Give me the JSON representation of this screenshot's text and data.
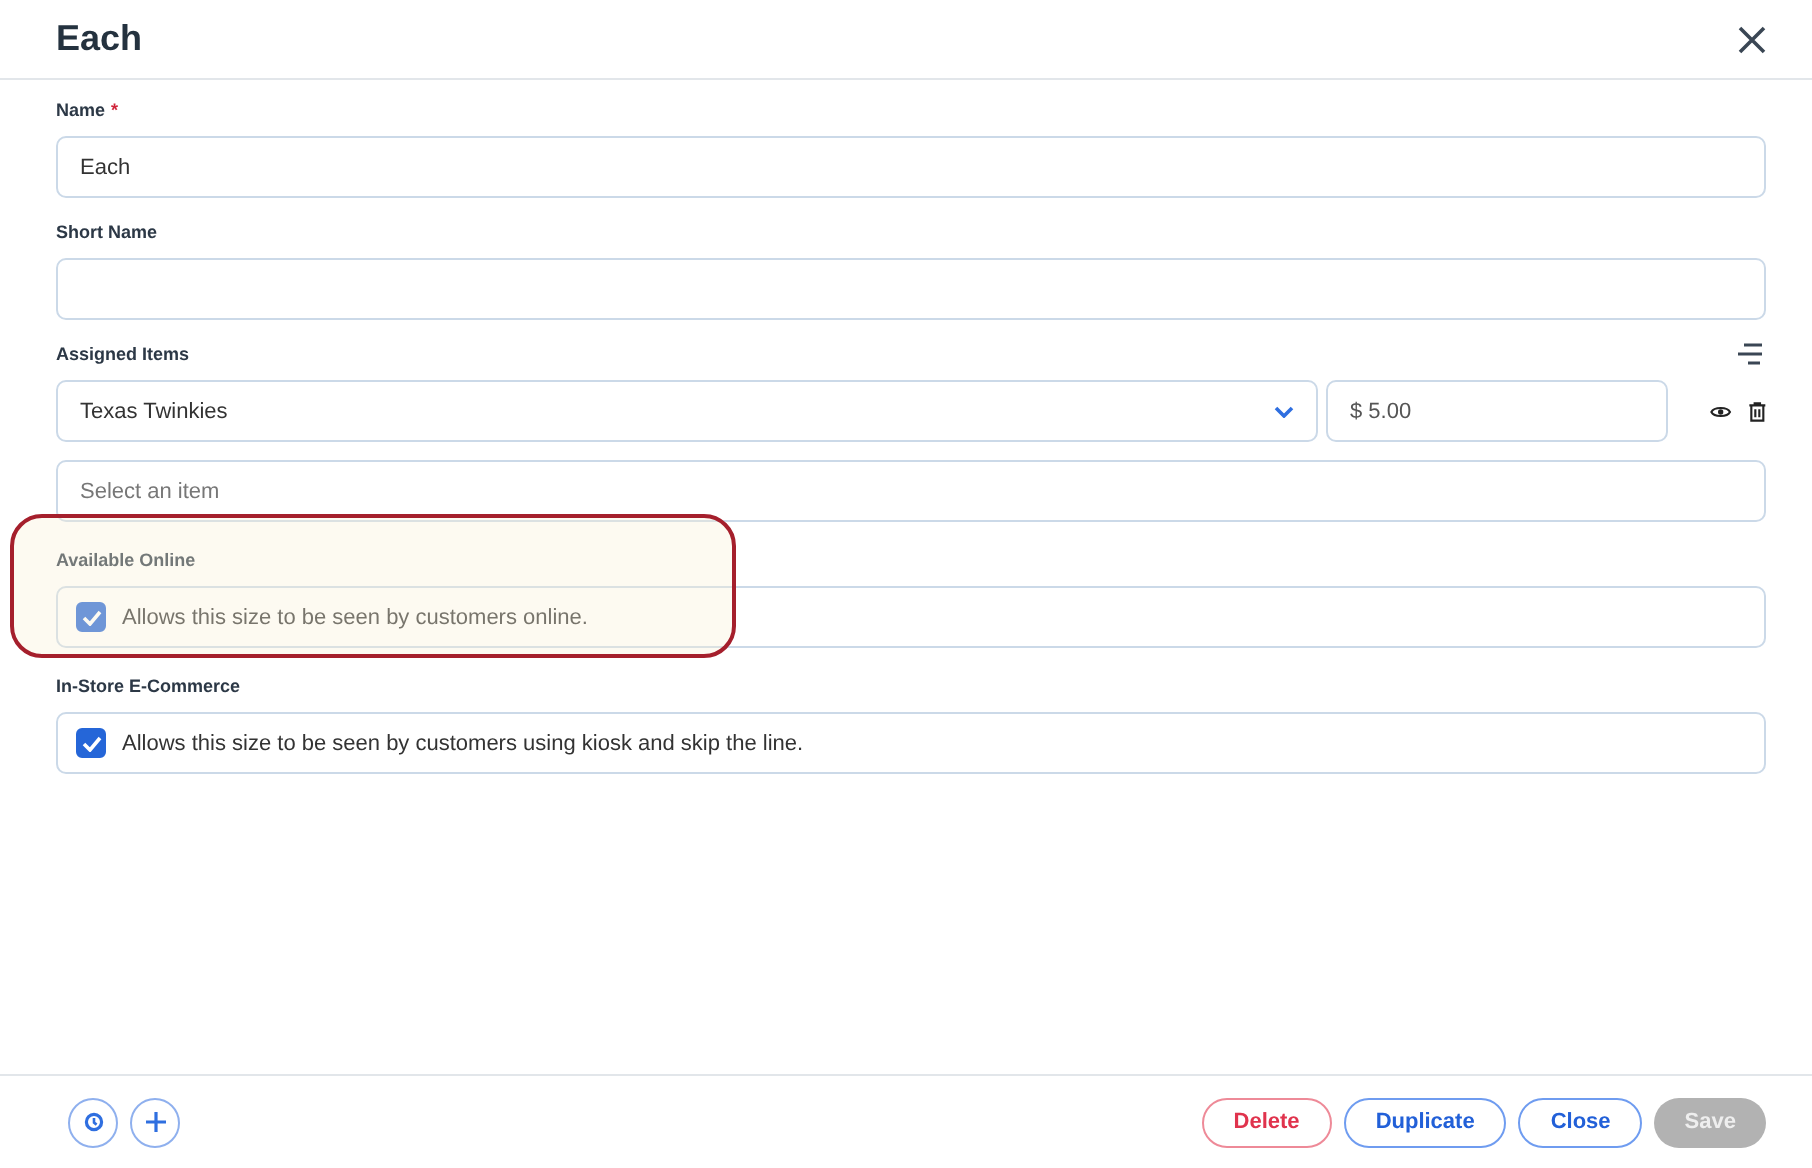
{
  "dialog": {
    "title": "Each"
  },
  "name_field": {
    "label": "Name",
    "required_mark": "*",
    "value": "Each"
  },
  "short_name_field": {
    "label": "Short Name"
  },
  "assigned_items": {
    "label": "Assigned Items",
    "items": [
      {
        "name": "Texas Twinkies",
        "price": "$ 5.00"
      }
    ],
    "new_item_placeholder": "Select an item"
  },
  "options": [
    {
      "label": "Available Online",
      "text": "Allows this size to be seen by customers online.",
      "checked": true,
      "highlighted": true
    },
    {
      "label": "In-Store E-Commerce",
      "text": "Allows this size to be seen by customers using kiosk and skip the line.",
      "checked": true,
      "highlighted": false
    }
  ],
  "footer_buttons": [
    {
      "label": "Delete",
      "kind": "danger",
      "disabled": false
    },
    {
      "label": "Duplicate",
      "kind": "outline",
      "disabled": false
    },
    {
      "label": "Close",
      "kind": "outline",
      "disabled": false
    },
    {
      "label": "Save",
      "kind": "primary",
      "disabled": true
    }
  ]
}
